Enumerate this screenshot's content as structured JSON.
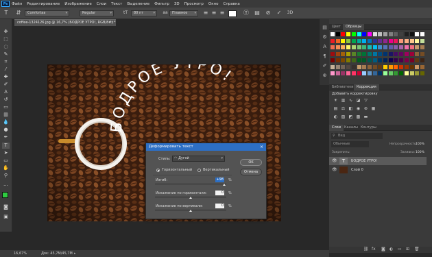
{
  "app": {
    "logo": "Ps"
  },
  "menu": [
    "Файл",
    "Редактирование",
    "Изображение",
    "Слои",
    "Текст",
    "Выделение",
    "Фильтр",
    "3D",
    "Просмотр",
    "Окно",
    "Справка"
  ],
  "options": {
    "font_family": "Comfortaa",
    "font_style": "Regular",
    "font_size": "80 пт",
    "antialias": "Плавное",
    "mode_3d": "3D"
  },
  "document": {
    "tab_title": "coffee-1324126.jpg @ 16,7% (БОДРОЕ УТРО!, RGB/8#) *",
    "tab_close": "×",
    "arc_text": "БОДРОЕ УТРО!"
  },
  "dialog": {
    "title": "Деформировать текст",
    "close": "×",
    "style_label": "Стиль:",
    "style_value": "Дугой",
    "horizontal_label": "Горизонтальный",
    "vertical_label": "Вертикальный",
    "orientation": "horizontal",
    "bend_label": "Изгиб:",
    "bend_value": "+98",
    "hdist_label": "Искажение по горизонтали:",
    "hdist_value": "0",
    "vdist_label": "Искажение по вертикали:",
    "vdist_value": "0",
    "percent": "%",
    "ok_label": "OK",
    "cancel_label": "Отмена"
  },
  "panels": {
    "color_tab": "Цвет",
    "swatches_tab": "Образцы",
    "library_tab": "Библиотеки",
    "adjust_tab": "Коррекция",
    "adjust_hint": "Добавить корректировку",
    "layers_tab": "Слои",
    "channels_tab": "Каналы",
    "paths_tab": "Контуры",
    "search_placeholder": "Вид",
    "blend_mode": "Обычные",
    "opacity_label": "Непрозрачность:",
    "opacity_value": "100%",
    "lock_label": "Закрепить:",
    "fill_label": "Заливка:",
    "fill_value": "100%"
  },
  "layers": [
    {
      "name": "БОДРОЕ УТРО!",
      "thumb": "T",
      "selected": true
    },
    {
      "name": "Слой 0",
      "thumb": "",
      "selected": false
    }
  ],
  "status": {
    "zoom": "16,67%",
    "doc_info": "Док: 45,7M/45,7M"
  },
  "colors": {
    "foreground": "#2ecc40",
    "background": "#ffffff",
    "accent": "#2d6fc4"
  }
}
